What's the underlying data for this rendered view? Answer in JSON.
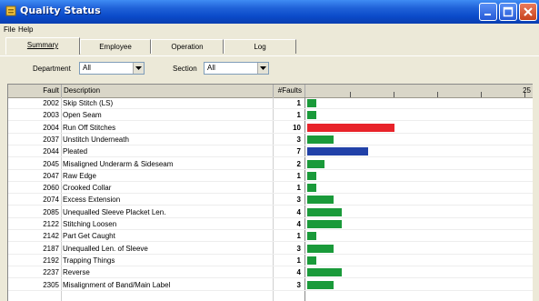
{
  "window": {
    "title": "Quality Status"
  },
  "menu": [
    "File",
    "Help"
  ],
  "tabs": [
    "Summary",
    "Employee",
    "Operation",
    "Log"
  ],
  "filters": {
    "department_label": "Department",
    "department_value": "All",
    "section_label": "Section",
    "section_value": "All"
  },
  "table": {
    "headers": {
      "fault": "Fault",
      "description": "Description",
      "nfaults": "#Faults",
      "scale_max": "25"
    },
    "rows": [
      {
        "fault": "2002",
        "description": "Skip Stitch (LS)",
        "count": "1",
        "value": 1,
        "color": "#1a9a3a"
      },
      {
        "fault": "2003",
        "description": "Open Seam",
        "count": "1",
        "value": 1,
        "color": "#1a9a3a"
      },
      {
        "fault": "2004",
        "description": "Run Off Stitches",
        "count": "10",
        "value": 10,
        "color": "#e8232a"
      },
      {
        "fault": "2037",
        "description": "Unstitch Underneath",
        "count": "3",
        "value": 3,
        "color": "#1a9a3a"
      },
      {
        "fault": "2044",
        "description": "Pleated",
        "count": "7",
        "value": 7,
        "color": "#2141a8"
      },
      {
        "fault": "2045",
        "description": "Misaligned Underarm & Sideseam",
        "count": "2",
        "value": 2,
        "color": "#1a9a3a"
      },
      {
        "fault": "2047",
        "description": "Raw Edge",
        "count": "1",
        "value": 1,
        "color": "#1a9a3a"
      },
      {
        "fault": "2060",
        "description": "Crooked Collar",
        "count": "1",
        "value": 1,
        "color": "#1a9a3a"
      },
      {
        "fault": "2074",
        "description": "Excess Extension",
        "count": "3",
        "value": 3,
        "color": "#1a9a3a"
      },
      {
        "fault": "2085",
        "description": "Unequalled Sleeve Placket Len.",
        "count": "4",
        "value": 4,
        "color": "#1a9a3a"
      },
      {
        "fault": "2122",
        "description": "Stitching Loosen",
        "count": "4",
        "value": 4,
        "color": "#1a9a3a"
      },
      {
        "fault": "2142",
        "description": "Part Get Caught",
        "count": "1",
        "value": 1,
        "color": "#1a9a3a"
      },
      {
        "fault": "2187",
        "description": "Unequalled Len. of Sleeve",
        "count": "3",
        "value": 3,
        "color": "#1a9a3a"
      },
      {
        "fault": "2192",
        "description": "Trapping Things",
        "count": "1",
        "value": 1,
        "color": "#1a9a3a"
      },
      {
        "fault": "2237",
        "description": "Reverse",
        "count": "4",
        "value": 4,
        "color": "#1a9a3a"
      },
      {
        "fault": "2305",
        "description": "Misalignment of Band/Main Label",
        "count": "3",
        "value": 3,
        "color": "#1a9a3a"
      }
    ]
  }
}
